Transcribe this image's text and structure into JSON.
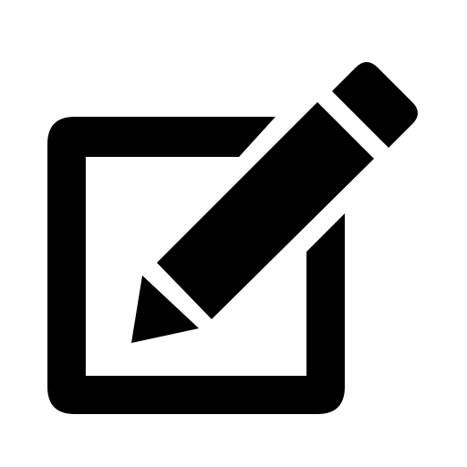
{
  "icon": {
    "name": "edit-icon",
    "color": "#000000",
    "background": "#ffffff"
  }
}
